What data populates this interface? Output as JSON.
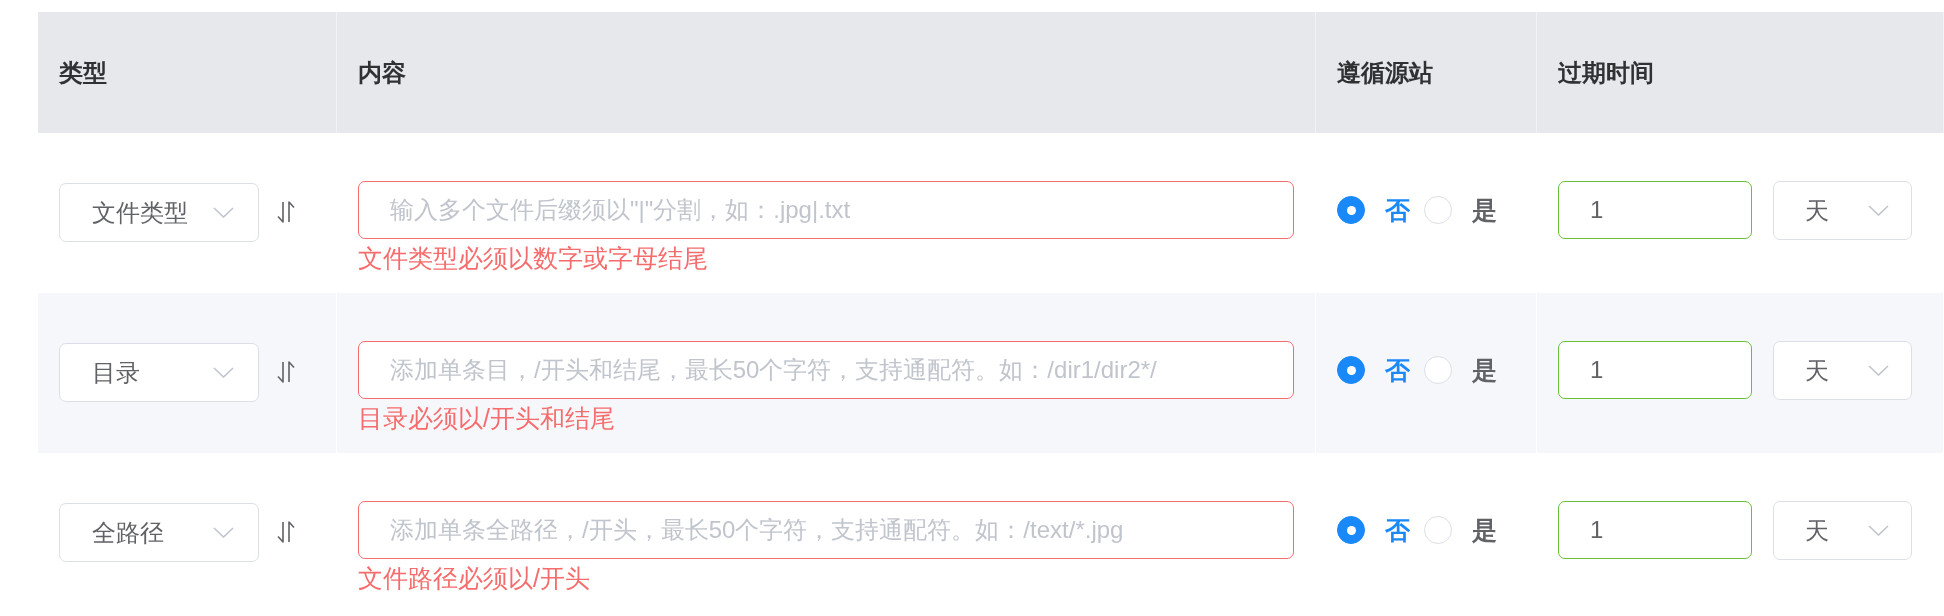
{
  "table": {
    "columns": [
      {
        "label": "类型"
      },
      {
        "label": "内容"
      },
      {
        "label": "遵循源站"
      },
      {
        "label": "过期时间"
      }
    ],
    "rows": [
      {
        "type": {
          "value": "文件类型"
        },
        "content": {
          "placeholder": "输入多个文件后缀须以\"|\"分割，如：.jpg|.txt",
          "invalid": true,
          "error": "文件类型必须以数字或字母结尾"
        },
        "follow_origin": [
          {
            "label": "否",
            "selected": true
          },
          {
            "label": "是",
            "selected": false
          }
        ],
        "expiry": {
          "value": "1",
          "valid": true,
          "unit": "天"
        }
      },
      {
        "type": {
          "value": "目录"
        },
        "content": {
          "placeholder": "添加单条目，/开头和结尾，最长50个字符，支持通配符。如：/dir1/dir2*/",
          "invalid": true,
          "error": "目录必须以/开头和结尾"
        },
        "follow_origin": [
          {
            "label": "否",
            "selected": true
          },
          {
            "label": "是",
            "selected": false
          }
        ],
        "expiry": {
          "value": "1",
          "valid": true,
          "unit": "天"
        }
      },
      {
        "type": {
          "value": "全路径"
        },
        "content": {
          "placeholder": "添加单条全路径，/开头，最长50个字符，支持通配符。如：/text/*.jpg",
          "invalid": true,
          "error": "文件路径必须以/开头"
        },
        "follow_origin": [
          {
            "label": "否",
            "selected": true
          },
          {
            "label": "是",
            "selected": false
          }
        ],
        "expiry": {
          "value": "1",
          "valid": true,
          "unit": "天"
        }
      }
    ]
  }
}
